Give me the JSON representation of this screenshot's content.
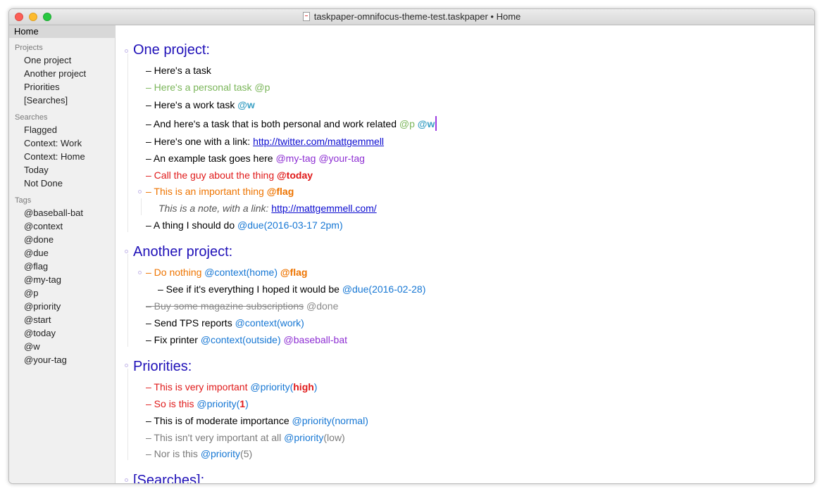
{
  "window": {
    "title": "taskpaper-omnifocus-theme-test.taskpaper • Home"
  },
  "sidebar": {
    "home": "Home",
    "projects_header": "Projects",
    "projects": [
      "One project",
      "Another project",
      "Priorities",
      "[Searches]"
    ],
    "searches_header": "Searches",
    "searches": [
      "Flagged",
      "Context: Work",
      "Context: Home",
      "Today",
      "Not Done"
    ],
    "tags_header": "Tags",
    "tags": [
      "@baseball-bat",
      "@context",
      "@done",
      "@due",
      "@flag",
      "@my-tag",
      "@p",
      "@priority",
      "@start",
      "@today",
      "@w",
      "@your-tag"
    ]
  },
  "colors": {
    "project": "#1f10b8",
    "personal": "#7bb65a",
    "work": "#3aa0c4",
    "purple_tag": "#8e2fd3",
    "blue_tag": "#1677d4",
    "today": "#e01a1a",
    "flag": "#ee7400",
    "done": "#8a8a8a"
  },
  "document": {
    "p1": {
      "title": "One project:",
      "t1": "– Here's a task",
      "t2_text": "– Here's a personal task ",
      "t2_tag": "@p",
      "t3_text": "– Here's a work task ",
      "t3_tag": "@w",
      "t4_text": "– And here's a task that is both personal and work related ",
      "t4_tag1": "@p",
      "t4_tag2": "@w",
      "t5_text": "– Here's one with a link: ",
      "t5_link": "http://twitter.com/mattgemmell",
      "t6_text": "– An example task goes here ",
      "t6_tag1": "@my-tag",
      "t6_tag2": "@your-tag",
      "t7_text": "– Call the guy about the thing ",
      "t7_tag": "@today",
      "t8_text": "– This is an important thing ",
      "t8_tag": "@flag",
      "note_text": "This is a note, with a link: ",
      "note_link": "http://mattgemmell.com/",
      "t9_text": "– A thing I should do ",
      "t9_tag": "@due(2016-03-17 2pm)"
    },
    "p2": {
      "title": "Another project:",
      "t1_text": "– Do nothing ",
      "t1_tag1": "@context(home)",
      "t1_tag2": "@flag",
      "t2_text": "– See if it's everything I hoped it would be ",
      "t2_tag": "@due(2016-02-28)",
      "t3_text": "– Buy some magazine subscriptions",
      "t3_tag": "@done",
      "t4_text": "– Send TPS reports ",
      "t4_tag": "@context(work)",
      "t5_text": "– Fix printer ",
      "t5_tag1": "@context(outside)",
      "t5_tag2": "@baseball-bat"
    },
    "p3": {
      "title": "Priorities:",
      "t1_text": "– This is very important ",
      "t1_tag": "@priority(",
      "t1_val": "high",
      "t1_close": ")",
      "t2_text": "– So is this ",
      "t2_tag": "@priority(",
      "t2_val": "1",
      "t2_close": ")",
      "t3_text": "– This is of moderate importance ",
      "t3_tag": "@priority(normal)",
      "t4_text": "– This isn't very important at all ",
      "t4_tag": "@priority",
      "t4_val": "(low)",
      "t5_text": "– Nor is this ",
      "t5_tag": "@priority",
      "t5_val": "(5)"
    },
    "p4": {
      "title": "[Searches]:"
    }
  }
}
